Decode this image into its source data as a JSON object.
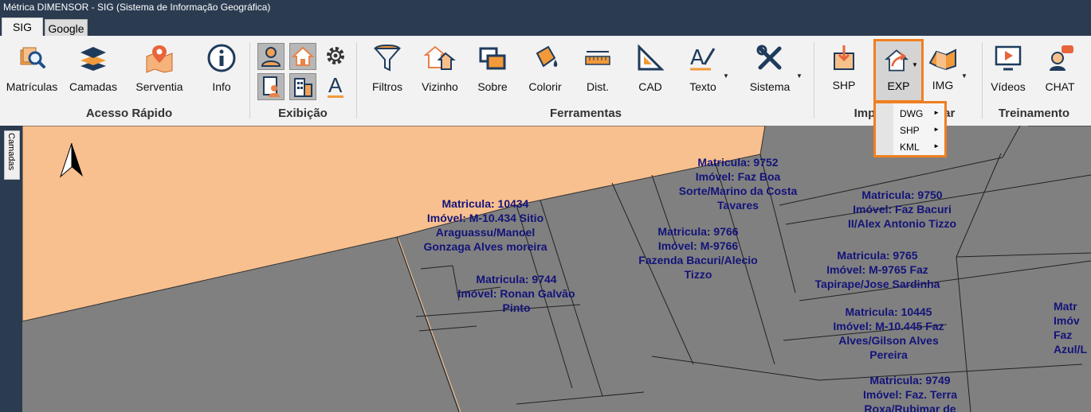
{
  "window": {
    "title": "Métrica DIMENSOR - SIG (Sistema de Informação Geográfica)"
  },
  "tabs": [
    {
      "label": "SIG",
      "active": true
    },
    {
      "label": "Google",
      "active": false
    }
  ],
  "ribbon": {
    "groups": {
      "acesso_rapido": "Acesso Rápido",
      "exibicao": "Exibição",
      "ferramentas": "Ferramentas",
      "importar_exportar": "Importar/Exportar",
      "treinamento": "Treinamento"
    },
    "buttons": {
      "matriculas": "Matrículas",
      "camadas": "Camadas",
      "serventia": "Serventia",
      "info": "Info",
      "filtros": "Filtros",
      "vizinho": "Vizinho",
      "sobre": "Sobre",
      "colorir": "Colorir",
      "dist": "Dist.",
      "cad": "CAD",
      "texto": "Texto",
      "sistema": "Sistema",
      "shp": "SHP",
      "exp": "EXP",
      "img": "IMG",
      "videos": "Vídeos",
      "chat": "CHAT"
    },
    "small_buttons": {
      "exibicao_text_icon": "A"
    }
  },
  "exp_menu": {
    "items": [
      "DWG",
      "SHP",
      "KML"
    ]
  },
  "sidebar": {
    "tab_label": "Camadas"
  },
  "map": {
    "compass_label": "north-arrow",
    "parcels": [
      {
        "lines": [
          "Matricula: 10434",
          "Imóvel: M-10.434 Sitio",
          "Araguassu/Manoel",
          "Gonzaga Alves moreira"
        ]
      },
      {
        "lines": [
          "Matricula: 9744",
          "Imóvel: Ronan Galvão",
          "Pinto"
        ]
      },
      {
        "lines": [
          "Matricula: 9752",
          "Imóvel: Faz Boa",
          "Sorte/Marino da Costa",
          "Tavares"
        ]
      },
      {
        "lines": [
          "Matricula: 9766",
          "Imóvel: M-9766",
          "Fazenda Bacuri/Alecio",
          "Tizzo"
        ]
      },
      {
        "lines": [
          "Matricula: 9750",
          "Imóvel: Faz Bacuri",
          "II/Alex Antonio Tizzo"
        ]
      },
      {
        "lines": [
          "Matricula: 9765",
          "Imóvel: M-9765 Faz",
          "Tapirape/Jose Sardinha"
        ]
      },
      {
        "lines": [
          "Matricula: 10445",
          "Imóvel: M-10.445 Faz",
          "Alves/Gilson Alves",
          "Pereira"
        ]
      },
      {
        "lines": [
          "Matricula: 9749",
          "Imóvel: Faz. Terra",
          "Roxa/Rubimar de"
        ]
      },
      {
        "lines": [
          "Matr",
          "Imóv",
          "Faz",
          "Azul/L"
        ]
      }
    ]
  },
  "colors": {
    "accent_highlight": "#f07f21",
    "parcel_fill": "#808080",
    "selected_parcel": "#f8c08f",
    "label_text": "#13137a",
    "titlebar": "#2b3b50"
  }
}
